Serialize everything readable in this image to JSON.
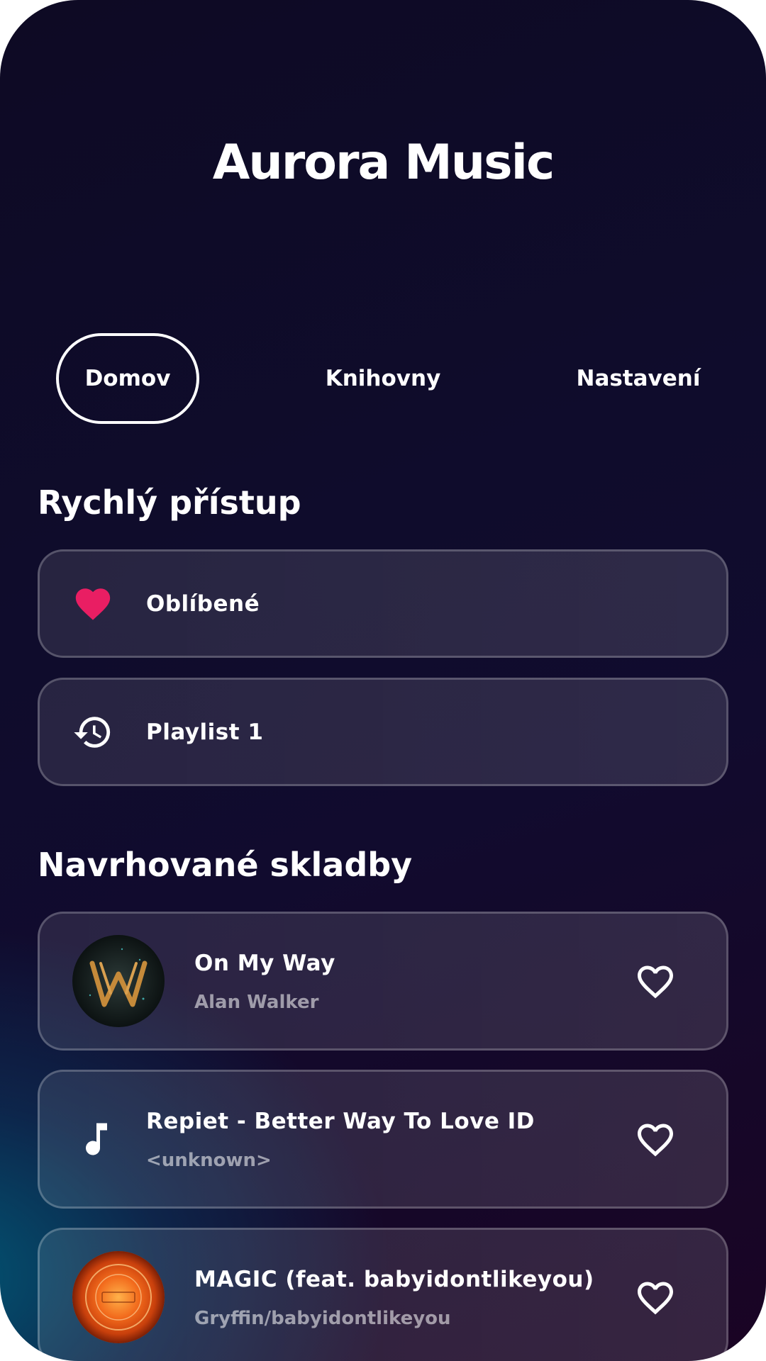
{
  "app": {
    "title": "Aurora Music"
  },
  "tabs": [
    {
      "label": "Domov",
      "active": true
    },
    {
      "label": "Knihovny",
      "active": false
    },
    {
      "label": "Nastavení",
      "active": false
    }
  ],
  "quick_access": {
    "heading": "Rychlý přístup",
    "items": [
      {
        "label": "Oblíbené",
        "icon": "heart-icon",
        "icon_color": "#e91e63"
      },
      {
        "label": "Playlist 1",
        "icon": "history-icon"
      }
    ]
  },
  "suggested": {
    "heading": "Navrhované skladby",
    "songs": [
      {
        "title": "On My Way",
        "artist": "Alan Walker",
        "artwork": "album-art-walker-logo"
      },
      {
        "title": "Repiet - Better Way To Love ID",
        "artist": "<unknown>",
        "artwork": "music-note-icon"
      },
      {
        "title": "MAGIC (feat. babyidontlikeyou)",
        "artist": "Gryffin/babyidontlikeyou",
        "artwork": "album-art-pulse"
      }
    ]
  },
  "colors": {
    "accent_heart": "#e91e63",
    "text_primary": "#ffffff",
    "text_secondary": "#9a9aa6"
  }
}
